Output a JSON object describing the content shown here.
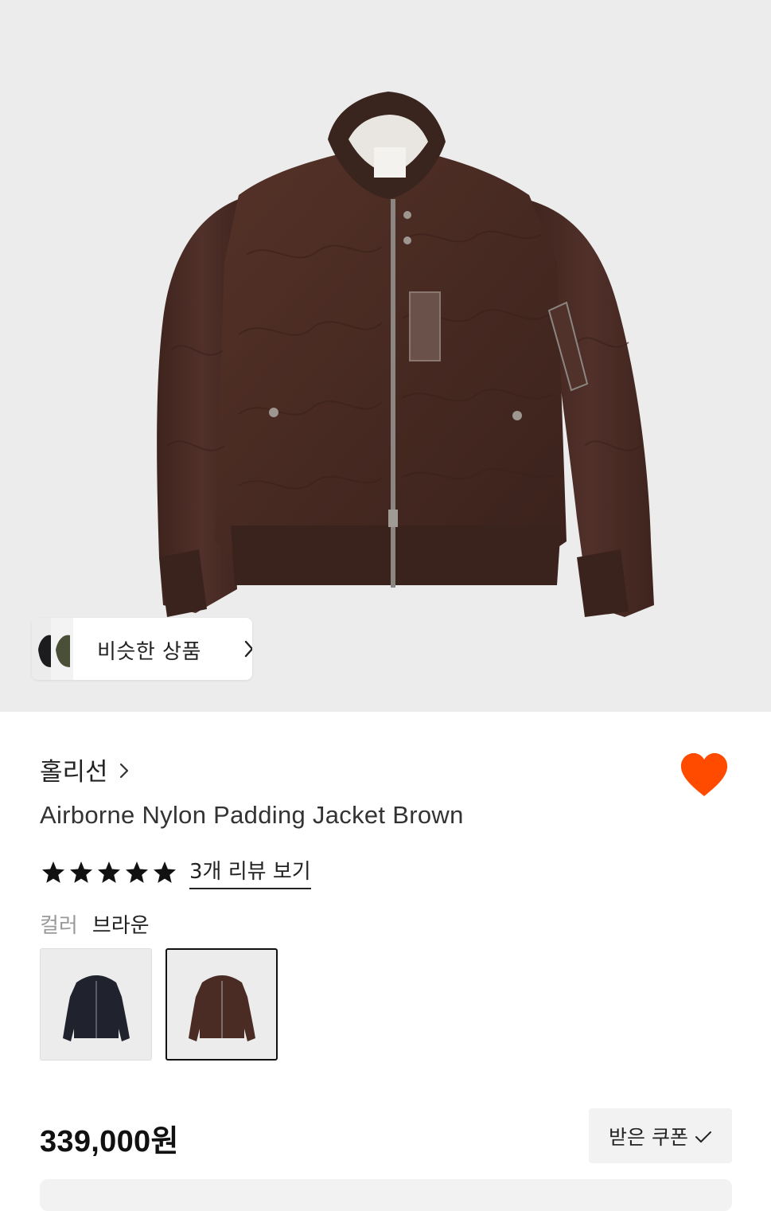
{
  "hero": {
    "image_alt": "jacket-photo",
    "similar_button_label": "비슷한 상품"
  },
  "brand": {
    "name": "홀리선"
  },
  "product": {
    "name": "Airborne Nylon Padding Jacket Brown",
    "rating_stars": 5,
    "review_link_label": "3개 리뷰 보기",
    "wishlisted": true
  },
  "color": {
    "label": "컬러",
    "selected_value": "브라운",
    "options": [
      "navy",
      "brown"
    ]
  },
  "price": {
    "value": "339,000원"
  },
  "coupon": {
    "label": "받은 쿠폰"
  },
  "colors": {
    "accent_heart": "#ff4b00",
    "text_primary": "#111111",
    "text_muted": "#999999",
    "hero_bg": "#ececec",
    "jacket_brown": "#4a2c25"
  }
}
